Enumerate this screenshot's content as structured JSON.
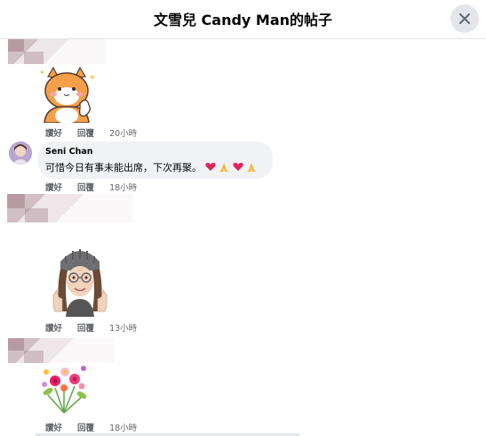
{
  "header": {
    "title": "文雪兒 Candy Man的帖子",
    "close_icon": "close-icon"
  },
  "comments": [
    {
      "author": "",
      "kind": "sticker",
      "sticker": "shiba-dog-sticker",
      "like_label": "讚好",
      "reply_label": "回覆",
      "time": "20小時"
    },
    {
      "author": "Seni Chan",
      "kind": "text",
      "text": "可惜今日有事未能出席，下次再聚。",
      "like_label": "讚好",
      "reply_label": "回覆",
      "time": "18小時"
    },
    {
      "author": "",
      "kind": "sticker",
      "sticker": "avatar-thumbs-up-sticker",
      "like_label": "讚好",
      "reply_label": "回覆",
      "time": "13小時"
    },
    {
      "author": "",
      "kind": "sticker",
      "sticker": "flower-bouquet-sticker",
      "like_label": "讚好",
      "reply_label": "回覆",
      "time": "18小時"
    }
  ],
  "colors": {
    "bubble_bg": "#f0f2f5",
    "meta_text": "#65676b",
    "close_bg": "#e4e6eb"
  }
}
